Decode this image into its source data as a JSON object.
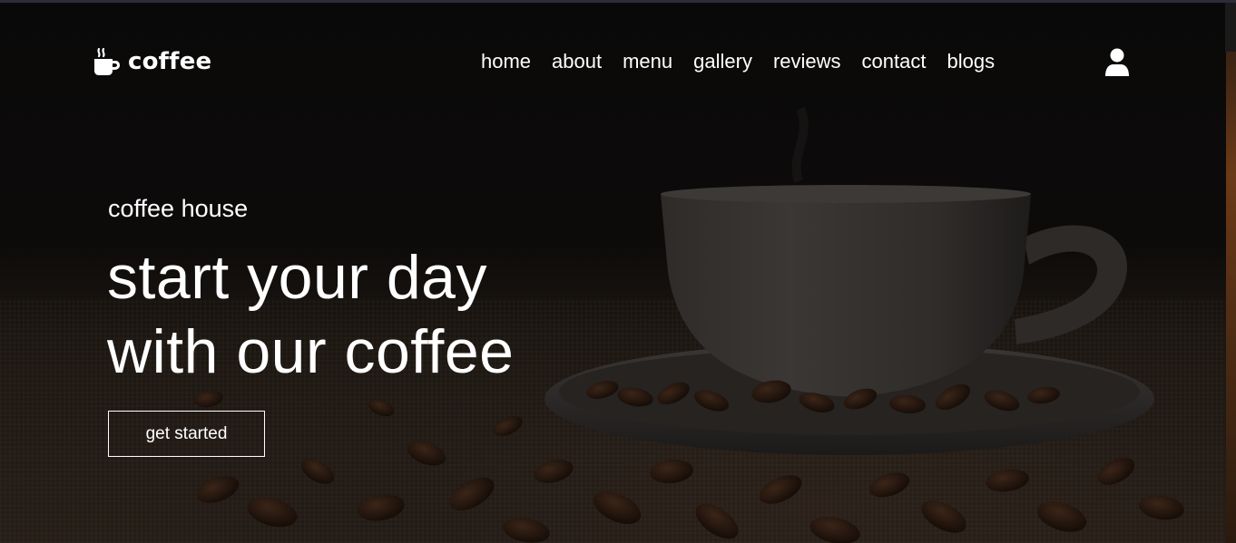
{
  "brand": {
    "name": "coffee",
    "icon": "mug-hot-icon"
  },
  "nav": {
    "items": [
      {
        "label": "home"
      },
      {
        "label": "about"
      },
      {
        "label": "menu"
      },
      {
        "label": "gallery"
      },
      {
        "label": "reviews"
      },
      {
        "label": "contact"
      },
      {
        "label": "blogs"
      }
    ],
    "user_icon": "user-icon"
  },
  "hero": {
    "eyebrow": "coffee house",
    "headline_line1": "start your day",
    "headline_line2": "with our coffee",
    "cta_label": "get started"
  },
  "colors": {
    "text": "#ffffff",
    "background": "#0b0a09",
    "accent_brown": "#6b3a18"
  }
}
